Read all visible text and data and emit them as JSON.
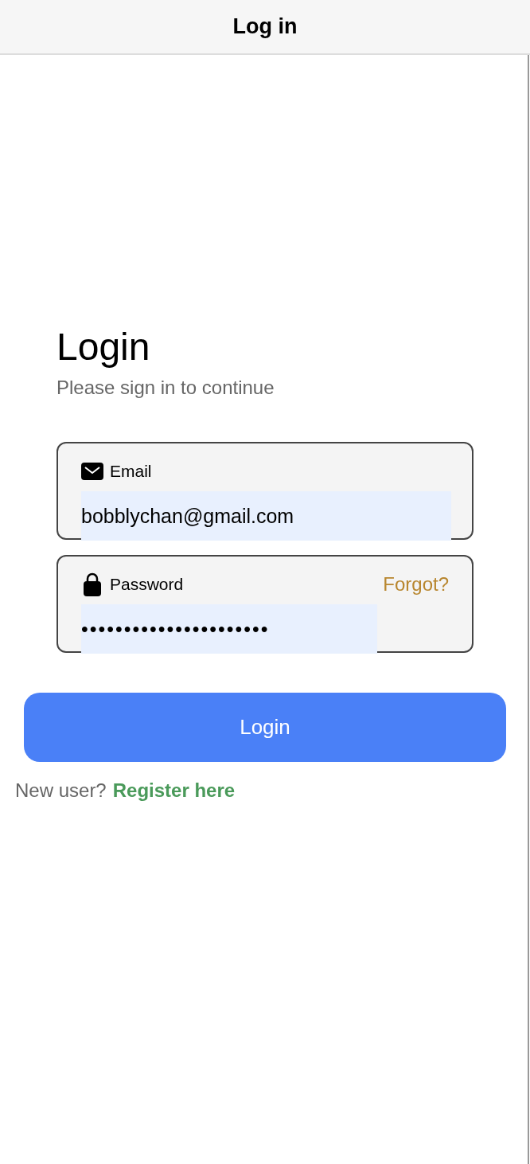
{
  "header": {
    "title": "Log in"
  },
  "heading": "Login",
  "subtitle": "Please sign in to continue",
  "fields": [
    {
      "kind": "email",
      "label": "Email",
      "value": "bobblychan@gmail.com"
    },
    {
      "kind": "password",
      "label": "Password",
      "value": "••••••••••••••••••••••",
      "link": "Forgot?"
    }
  ],
  "login_button": "Login",
  "register": {
    "prompt": "New user?",
    "link": "Register here"
  }
}
